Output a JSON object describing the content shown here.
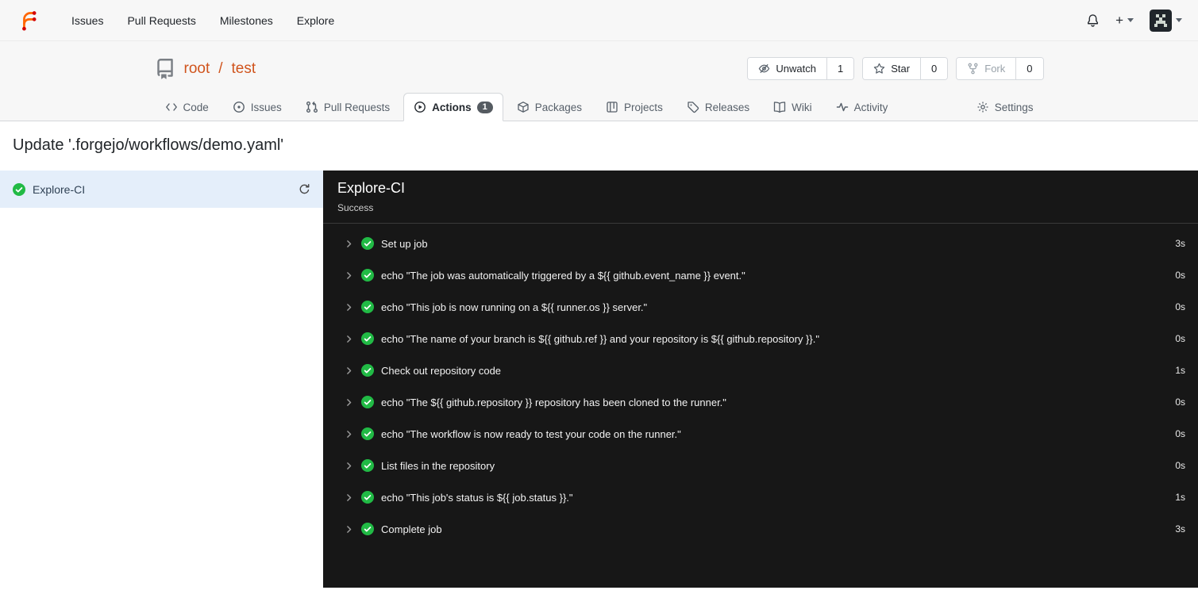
{
  "colors": {
    "primary": "#d0541d",
    "success": "#21ba45",
    "header_bg": "#f7f7f7",
    "tab_border": "#d4d7da",
    "badge_bg": "#555b61",
    "selected_bg": "#e4eefa",
    "selected_text": "#2f4154",
    "panel_bg": "#171717",
    "panel_border": "#3a3a3a"
  },
  "navbar": {
    "items": [
      {
        "label": "Issues"
      },
      {
        "label": "Pull Requests"
      },
      {
        "label": "Milestones"
      },
      {
        "label": "Explore"
      }
    ],
    "create_label": "+"
  },
  "repo": {
    "owner": "root",
    "separator": "/",
    "name": "test",
    "actions": [
      {
        "label": "Unwatch",
        "count": "1"
      },
      {
        "label": "Star",
        "count": "0"
      },
      {
        "label": "Fork",
        "count": "0"
      }
    ]
  },
  "tabs": [
    {
      "label": "Code"
    },
    {
      "label": "Issues"
    },
    {
      "label": "Pull Requests"
    },
    {
      "label": "Actions",
      "badge": "1"
    },
    {
      "label": "Packages"
    },
    {
      "label": "Projects"
    },
    {
      "label": "Releases"
    },
    {
      "label": "Wiki"
    },
    {
      "label": "Activity"
    },
    {
      "label": "Settings"
    }
  ],
  "run": {
    "title": "Update '.forgejo/workflows/demo.yaml'",
    "job_name": "Explore-CI",
    "status": "Success",
    "steps": [
      {
        "label": "Set up job",
        "duration": "3s"
      },
      {
        "label": "echo \"The job was automatically triggered by a ${{ github.event_name }} event.\"",
        "duration": "0s"
      },
      {
        "label": "echo \"This job is now running on a ${{ runner.os }} server.\"",
        "duration": "0s"
      },
      {
        "label": "echo \"The name of your branch is ${{ github.ref }} and your repository is ${{ github.repository }}.\"",
        "duration": "0s"
      },
      {
        "label": "Check out repository code",
        "duration": "1s"
      },
      {
        "label": "echo \"The ${{ github.repository }} repository has been cloned to the runner.\"",
        "duration": "0s"
      },
      {
        "label": "echo \"The workflow is now ready to test your code on the runner.\"",
        "duration": "0s"
      },
      {
        "label": "List files in the repository",
        "duration": "0s"
      },
      {
        "label": "echo \"This job's status is ${{ job.status }}.\"",
        "duration": "1s"
      },
      {
        "label": "Complete job",
        "duration": "3s"
      }
    ]
  }
}
